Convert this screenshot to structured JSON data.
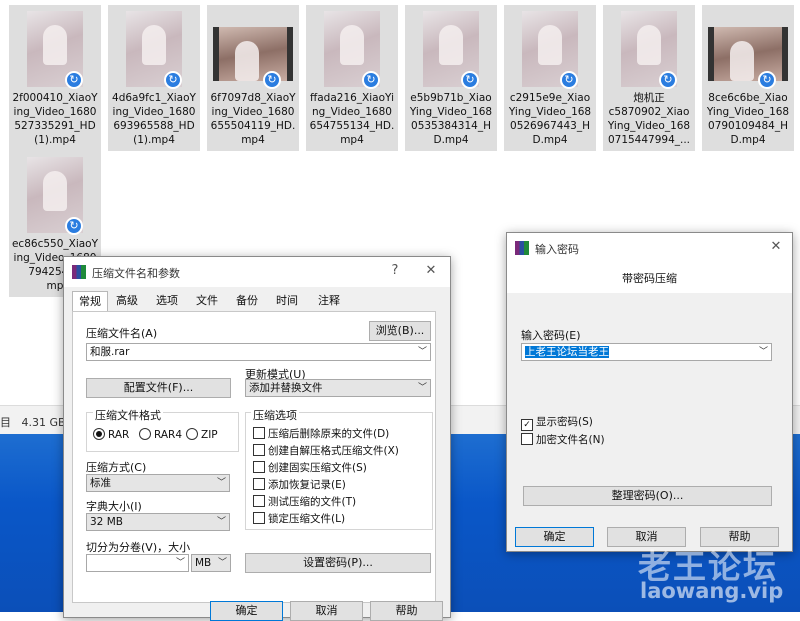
{
  "files": [
    {
      "name": "2f000410_XiaoYing_Video_1680527335291_HD(1).mp4",
      "line1": "2f000410_XiaoY",
      "line2": "ing_Video_1680",
      "line3": "527335291_HD",
      "line4": "(1).mp4"
    },
    {
      "name": "4d6a9fc1_XiaoYing_Video_1680693965588_HD(1).mp4",
      "line1": "4d6a9fc1_XiaoY",
      "line2": "ing_Video_1680",
      "line3": "693965588_HD",
      "line4": "(1).mp4"
    },
    {
      "name": "6f7097d8_XiaoYing_Video_1680655504119_HD.mp4",
      "line1": "6f7097d8_XiaoY",
      "line2": "ing_Video_1680",
      "line3": "655504119_HD.",
      "line4": "mp4"
    },
    {
      "name": "ffada216_XiaoYing_Video_1680654755134_HD.mp4",
      "line1": "ffada216_XiaoYi",
      "line2": "ng_Video_1680",
      "line3": "654755134_HD.",
      "line4": "mp4"
    },
    {
      "name": "e5b9b71b_XiaoYing_Video_1680535384314_HD.mp4",
      "line1": "e5b9b71b_Xiao",
      "line2": "Ying_Video_168",
      "line3": "0535384314_H",
      "line4": "D.mp4"
    },
    {
      "name": "c2915e9e_XiaoYing_Video_1680526967443_HD.mp4",
      "line1": "c2915e9e_Xiao",
      "line2": "Ying_Video_168",
      "line3": "0526967443_H",
      "line4": "D.mp4"
    },
    {
      "name": "炮机正c5870902_XiaoYing_Video_1680715447994",
      "line1": "炮机正",
      "line2": "c5870902_Xiao",
      "line3": "Ying_Video_168",
      "line4": "0715447994_..."
    },
    {
      "name": "8ce6c6be_XiaoYing_Video_1680790109484_HD.mp4",
      "line1": "8ce6c6be_Xiao",
      "line2": "Ying_Video_168",
      "line3": "0790109484_H",
      "line4": "D.mp4"
    },
    {
      "name": "ec86c550_XiaoYing_Video_168079425452",
      "line1": "ec86c550_XiaoY",
      "line2": "ing_Video_1680",
      "line3": "79425452",
      "line4": "mp"
    }
  ],
  "status": {
    "disk_size": "4.31 GB",
    "item_prefix": "目"
  },
  "archive_dialog": {
    "title": "压缩文件名和参数",
    "tabs": [
      "常规",
      "高级",
      "选项",
      "文件",
      "备份",
      "时间",
      "注释"
    ],
    "archive_name_label": "压缩文件名(A)",
    "browse_button": "浏览(B)...",
    "archive_name": "和服.rar",
    "profiles_button": "配置文件(F)...",
    "update_mode_label": "更新模式(U)",
    "update_mode": "添加并替换文件",
    "format_label": "压缩文件格式",
    "formats": [
      "RAR",
      "RAR4",
      "ZIP"
    ],
    "options_label": "压缩选项",
    "options": [
      {
        "label": "压缩后删除原来的文件(D)",
        "checked": false
      },
      {
        "label": "创建自解压格式压缩文件(X)",
        "checked": false
      },
      {
        "label": "创建固实压缩文件(S)",
        "checked": false
      },
      {
        "label": "添加恢复记录(E)",
        "checked": false
      },
      {
        "label": "测试压缩的文件(T)",
        "checked": false
      },
      {
        "label": "锁定压缩文件(L)",
        "checked": false
      }
    ],
    "method_label": "压缩方式(C)",
    "method": "标准",
    "dict_label": "字典大小(I)",
    "dict": "32 MB",
    "split_label": "切分为分卷(V)，大小",
    "split_unit": "MB",
    "set_password_button": "设置密码(P)...",
    "ok": "确定",
    "cancel": "取消",
    "help": "帮助"
  },
  "password_dialog": {
    "title": "输入密码",
    "subtitle": "带密码压缩",
    "password_label": "输入密码(E)",
    "password_value": "上老王论坛当老王",
    "show_password": "显示密码(S)",
    "show_password_checked": true,
    "encrypt_names": "加密文件名(N)",
    "encrypt_names_checked": false,
    "organize_button": "整理密码(O)...",
    "ok": "确定",
    "cancel": "取消",
    "help": "帮助"
  },
  "watermark": {
    "cn": "老王论坛",
    "url": "laowang.vip"
  }
}
